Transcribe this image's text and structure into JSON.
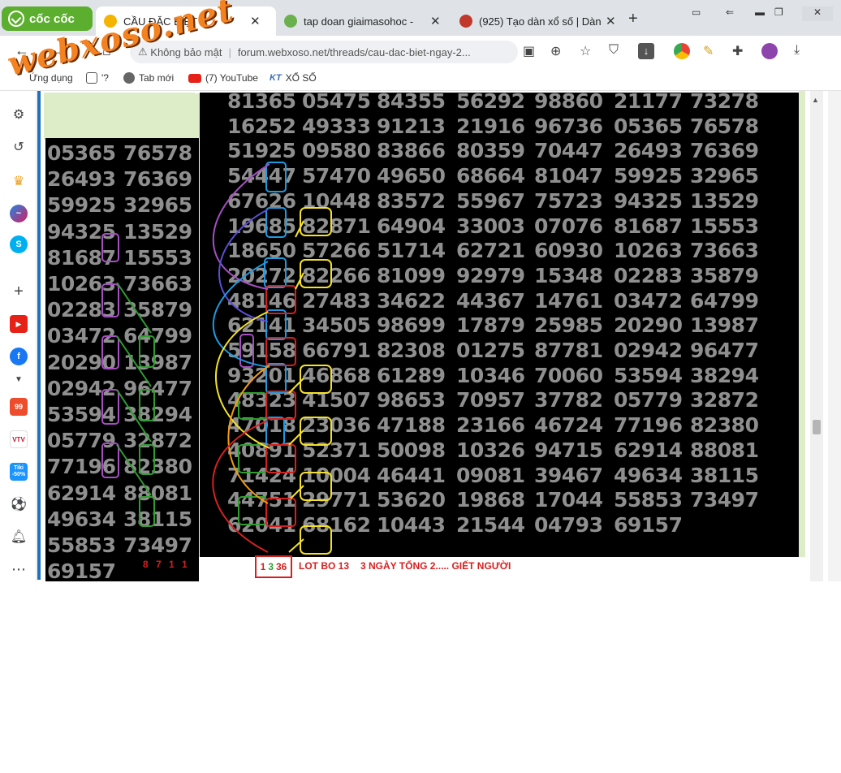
{
  "browser": {
    "brand_label": "cốc cốc",
    "tabs": [
      {
        "title": "CẦU ĐẶC BIỆT",
        "icon_color": "#f5b400",
        "active": true
      },
      {
        "title": "tap doan giaimasohoc -",
        "icon_color": "#6ab04c",
        "active": false
      },
      {
        "title": "(925) Tạo dàn xổ số | Dàn",
        "icon_color": "#c0392b",
        "active": false
      }
    ],
    "new_tab_label": "+",
    "security_label": "Không bảo mật",
    "url": "forum.webxoso.net/threads/cau-dac-biet-ngay-2...",
    "bookmarks": [
      {
        "label": "Ứng dụng",
        "icon": "apps-icon"
      },
      {
        "label": "'?",
        "icon": "folder-icon"
      },
      {
        "label": "Tab mới",
        "icon": "globe-icon"
      },
      {
        "label": "(7) YouTube",
        "icon": "youtube-icon"
      },
      {
        "label": "XỔ SỐ",
        "icon": "kt-icon"
      }
    ],
    "watermark": "webxoso.net"
  },
  "sidebar": {
    "badges": {
      "shopee": "99",
      "vtv": "VTV",
      "tiki": "Tiki -50%"
    }
  },
  "left_grid": [
    [
      "05365",
      "76578"
    ],
    [
      "26493",
      "76369"
    ],
    [
      "59925",
      "32965"
    ],
    [
      "94325",
      "13529"
    ],
    [
      "81687",
      "15553"
    ],
    [
      "10263",
      "73663"
    ],
    [
      "02283",
      "35879"
    ],
    [
      "03472",
      "64799"
    ],
    [
      "20290",
      "13987"
    ],
    [
      "02942",
      "96477"
    ],
    [
      "53594",
      "38294"
    ],
    [
      "05779",
      "32872"
    ],
    [
      "77196",
      "82380"
    ],
    [
      "62914",
      "88081"
    ],
    [
      "49634",
      "38115"
    ],
    [
      "55853",
      "73497"
    ],
    [
      "69157",
      ""
    ]
  ],
  "left_note": "8 7 1 1",
  "main_grid": [
    [
      "81365",
      "05475",
      "84355",
      "56292",
      "98860",
      "21177",
      "73278"
    ],
    [
      "16252",
      "49333",
      "91213",
      "21916",
      "96736",
      "05365",
      "76578"
    ],
    [
      "51925",
      "09580",
      "83866",
      "80359",
      "70447",
      "26493",
      "76369"
    ],
    [
      "54447",
      "57470",
      "49650",
      "68664",
      "81047",
      "59925",
      "32965"
    ],
    [
      "67626",
      "10448",
      "83572",
      "55967",
      "75723",
      "94325",
      "13529"
    ],
    [
      "19685",
      "82871",
      "64904",
      "33003",
      "07076",
      "81687",
      "15553"
    ],
    [
      "18650",
      "57266",
      "51714",
      "62721",
      "60930",
      "10263",
      "73663"
    ],
    [
      "20272",
      "82266",
      "81099",
      "92979",
      "15348",
      "02283",
      "35879"
    ],
    [
      "48146",
      "27483",
      "34622",
      "44367",
      "14761",
      "03472",
      "64799"
    ],
    [
      "62141",
      "34505",
      "98699",
      "17879",
      "25985",
      "20290",
      "13987"
    ],
    [
      "59158",
      "66791",
      "82308",
      "01275",
      "87781",
      "02942",
      "96477"
    ],
    [
      "93201",
      "46868",
      "61289",
      "10346",
      "70060",
      "53594",
      "38294"
    ],
    [
      "48323",
      "41507",
      "98653",
      "70957",
      "37782",
      "05779",
      "32872"
    ],
    [
      "47018",
      "23036",
      "47188",
      "23166",
      "46724",
      "77196",
      "82380"
    ],
    [
      "40891",
      "52371",
      "50098",
      "10326",
      "94715",
      "62914",
      "88081"
    ],
    [
      "71424",
      "10004",
      "46441",
      "09081",
      "39467",
      "49634",
      "38115"
    ],
    [
      "44751",
      "29771",
      "53620",
      "19868",
      "17044",
      "55853",
      "73497"
    ],
    [
      "62041",
      "68162",
      "10443",
      "21544",
      "04793",
      "69157",
      ""
    ]
  ],
  "result": {
    "n1": "1",
    "n2": "3",
    "n3": "36",
    "c1": "#d62020",
    "c2": "#2e9e2e",
    "c3": "#d62020"
  },
  "captions": [
    "LOT BO 13",
    "3 NGÀY TỔNG 2..... GIẾT NGƯỜI"
  ]
}
